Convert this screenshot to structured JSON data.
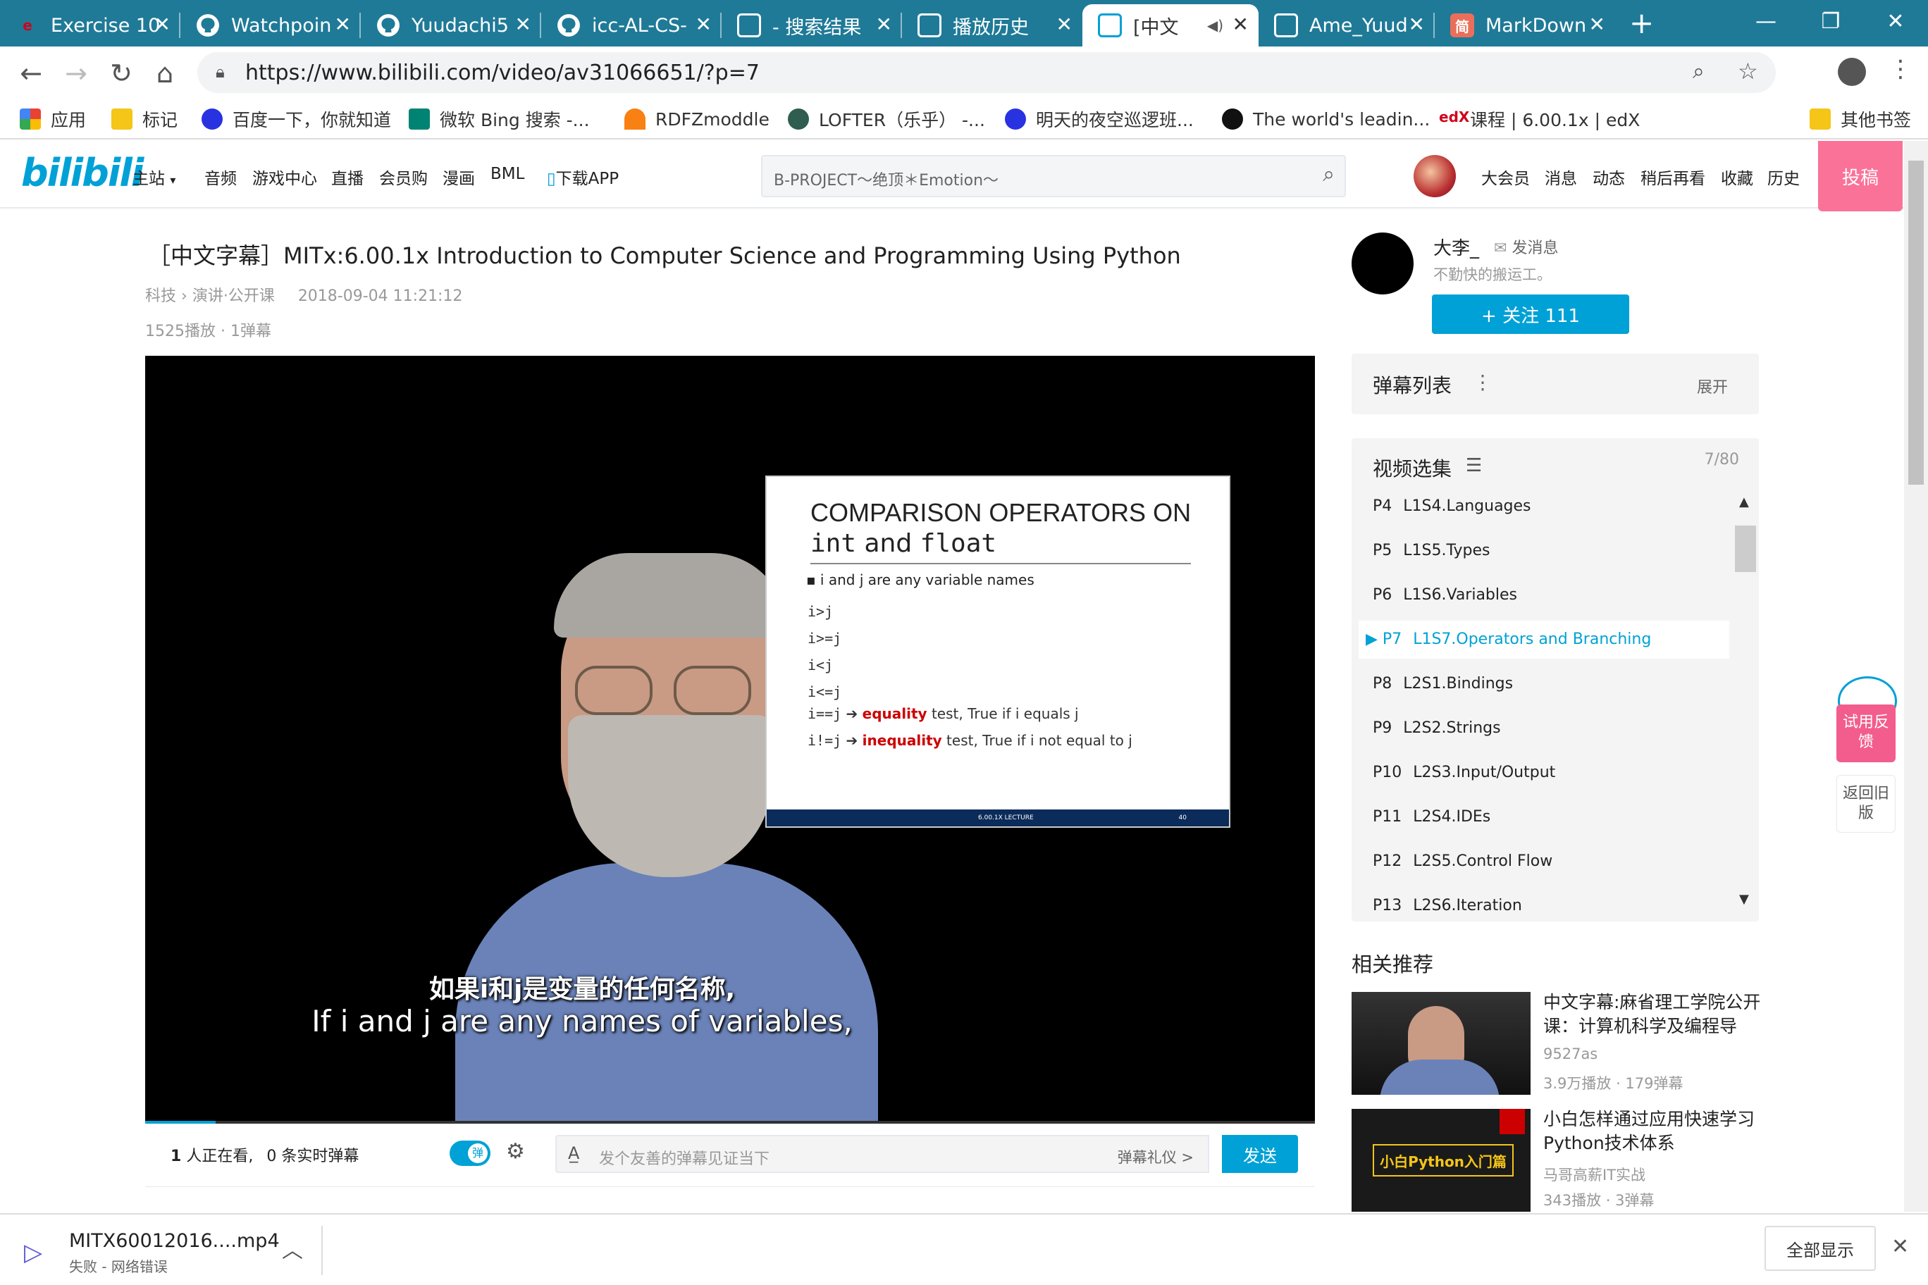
{
  "browser": {
    "tabs": [
      {
        "title": "Exercise 10",
        "favicon": "edx-icon",
        "color": "#e5e5e5"
      },
      {
        "title": "Watchpoin",
        "favicon": "github-icon",
        "color": "#fff"
      },
      {
        "title": "Yuudachi5",
        "favicon": "github-icon",
        "color": "#fff"
      },
      {
        "title": "icc-AL-CS-",
        "favicon": "github-icon",
        "color": "#fff"
      },
      {
        "title": " - 搜索结果",
        "favicon": "bilibili-tv-icon",
        "color": "#00a1d6"
      },
      {
        "title": "播放历史",
        "favicon": "bilibili-tv-icon",
        "color": "#00a1d6"
      },
      {
        "title": "[中文",
        "favicon": "bilibili-tv-icon",
        "color": "#00a1d6"
      },
      {
        "title": "Ame_Yuud",
        "favicon": "bilibili-tv-icon",
        "color": "#00a1d6"
      },
      {
        "title": "MarkDown",
        "favicon": "jianshu-icon",
        "color": "#ea6f5a"
      }
    ],
    "new_tab": "+",
    "close_glyph": "✕",
    "url": "https://www.bilibili.com/video/av31066651/?p=7",
    "bookmarks": [
      {
        "label": "应用",
        "icon": "apps-grid-icon",
        "color": "#e94235"
      },
      {
        "label": "标记",
        "icon": "folder-icon",
        "color": "#f5c518"
      },
      {
        "label": "百度一下，你就知道",
        "icon": "baidu-paw-icon",
        "color": "#2932e1"
      },
      {
        "label": "微软 Bing 搜索 -...",
        "icon": "bing-icon",
        "color": "#008373"
      },
      {
        "label": "RDFZmoddle",
        "icon": "moodle-icon",
        "color": "#f98012"
      },
      {
        "label": "LOFTER（乐乎） -...",
        "icon": "lofter-icon",
        "color": "#2f5d50"
      },
      {
        "label": "明天的夜空巡逻班...",
        "icon": "baidu-paw-icon",
        "color": "#2932e1"
      },
      {
        "label": "The world's leadin...",
        "icon": "github-icon",
        "color": "#111"
      },
      {
        "label": "课程 | 6.00.1x | edX",
        "icon": "edx-icon",
        "color": "#d0021b"
      }
    ],
    "other_bookmarks": "其他书签"
  },
  "site": {
    "logo": "bilibili",
    "nav": [
      "主站",
      "音频",
      "游戏中心",
      "直播",
      "会员购",
      "漫画",
      "BML",
      "下载APP"
    ],
    "search_placeholder": "B-PROJECT～绝顶＊Emotion～",
    "user_nav": [
      "大会员",
      "消息",
      "动态",
      "稍后再看",
      "收藏",
      "历史"
    ],
    "upload": "投稿"
  },
  "video": {
    "title": "［中文字幕］MITx:6.00.1x Introduction to Computer Science and Programming Using Python",
    "category": "科技",
    "subcategory": "演讲·公开课",
    "date": "2018-09-04 11:21:12",
    "stats": "1525播放 · 1弹幕",
    "subtitle_cn": "如果i和j是变量的任何名称,",
    "subtitle_en": "If i and j are any names of variables,",
    "progress": 0.06
  },
  "slide": {
    "title_line1": "COMPARISON OPERATORS ON",
    "title_line2a": "int",
    "title_line2b": "and",
    "title_line2c": "float",
    "bullet": "i and j are any variable names",
    "ops": [
      "i>j",
      "i>=j",
      "i<j",
      "i<=j"
    ],
    "eq_code": "i==j",
    "eq_label": "equality",
    "eq_rest": "test, True if i equals j",
    "neq_code": "i!=j",
    "neq_label": "inequality",
    "neq_rest": "test, True if i not equal to j",
    "footer_left": "6.00.1X LECTURE",
    "footer_right": "40"
  },
  "controls": {
    "watching_count": "1",
    "watching_text": "人正在看,",
    "realtime_count": "0",
    "realtime_text": "条实时弹幕",
    "danmaku_toggle": "弹",
    "input_placeholder": "发个友善的弹幕见证当下",
    "etiquette": "弹幕礼仪 >",
    "send": "发送"
  },
  "uploader": {
    "name": "大李_",
    "message": "发消息",
    "bio": "不勤快的搬运工。",
    "follow": "+ 关注 111"
  },
  "danmaku_list": {
    "title": "弹幕列表",
    "expand": "展开"
  },
  "playlist": {
    "title": "视频选集",
    "count": "7/80",
    "items": [
      {
        "p": "P4",
        "name": "L1S4.Languages",
        "active": false
      },
      {
        "p": "P5",
        "name": "L1S5.Types",
        "active": false
      },
      {
        "p": "P6",
        "name": "L1S6.Variables",
        "active": false
      },
      {
        "p": "P7",
        "name": "L1S7.Operators and Branching",
        "active": true
      },
      {
        "p": "P8",
        "name": "L2S1.Bindings",
        "active": false
      },
      {
        "p": "P9",
        "name": "L2S2.Strings",
        "active": false
      },
      {
        "p": "P10",
        "name": "L2S3.Input/Output",
        "active": false
      },
      {
        "p": "P11",
        "name": "L2S4.IDEs",
        "active": false
      },
      {
        "p": "P12",
        "name": "L2S5.Control Flow",
        "active": false
      },
      {
        "p": "P13",
        "name": "L2S6.Iteration",
        "active": false
      }
    ]
  },
  "related": {
    "title": "相关推荐",
    "items": [
      {
        "title": "中文字幕:麻省理工学院公开课：计算机科学及编程导",
        "author": "9527as",
        "stats": "3.9万播放 · 179弹幕"
      },
      {
        "title": "小白怎样通过应用快速学习Python技术体系",
        "author": "马哥高薪IT实战",
        "stats": "343播放 · 3弹幕",
        "thumb_text": "小白Python入门篇"
      }
    ]
  },
  "side_buttons": {
    "feedback": "试用反馈",
    "old": "返回旧版"
  },
  "download": {
    "filename": "MITX60012016....mp4",
    "status": "失败 - 网络错误",
    "show_all": "全部显示"
  }
}
